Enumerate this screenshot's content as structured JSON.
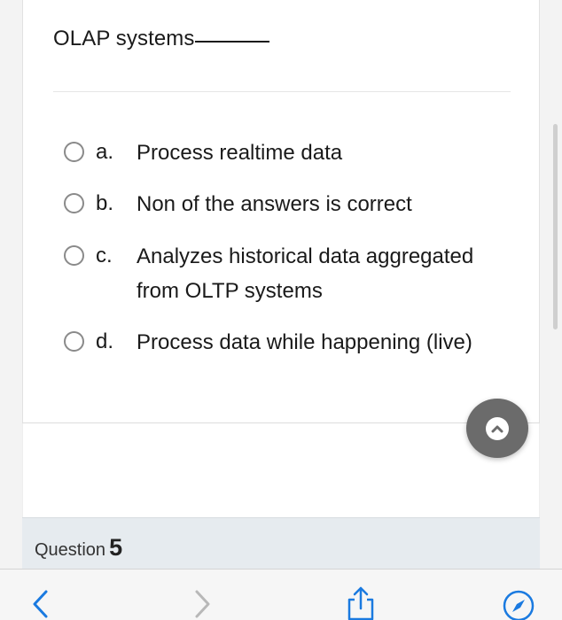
{
  "question": {
    "text": "OLAP systems"
  },
  "options": [
    {
      "letter": "a.",
      "text": "Process realtime data",
      "selected": false
    },
    {
      "letter": "b.",
      "text": "Non of the answers is correct",
      "selected": false
    },
    {
      "letter": "c.",
      "text": "Analyzes historical data aggregated from OLTP systems",
      "selected": false
    },
    {
      "letter": "d.",
      "text": "Process data while happening (live)",
      "selected": false
    }
  ],
  "next_question": {
    "label": "Question",
    "number": "5"
  },
  "colors": {
    "accent": "#1a7ae0",
    "fab": "#6b6b6b",
    "header_bg": "#e6ebef"
  },
  "toolbar": {
    "icons": [
      "back-icon",
      "forward-icon",
      "share-icon",
      "compass-icon"
    ]
  }
}
